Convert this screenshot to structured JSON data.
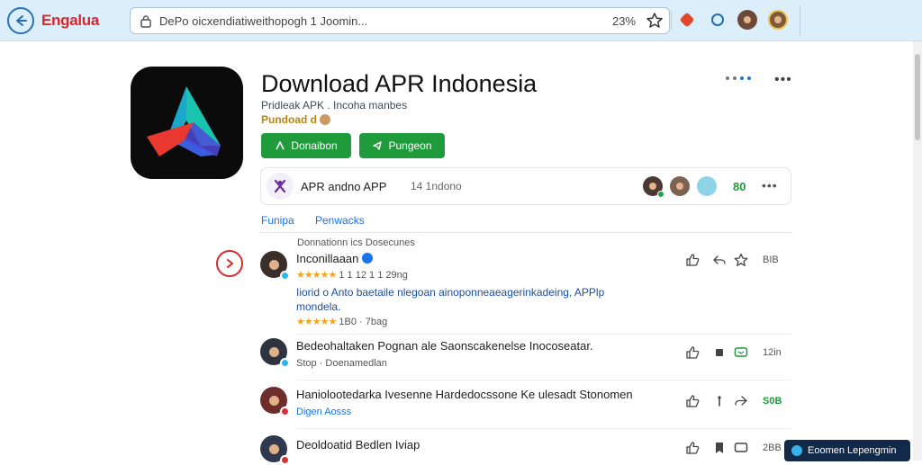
{
  "browser": {
    "app_name": "Engalua",
    "url": "DePo oicxendiatiweithopogh  1  Joomin...",
    "zoom": "23%"
  },
  "app": {
    "title": "Download APR Indonesia",
    "developer": "Pridleak APK . Incoha manbes",
    "category": "Pundoad d",
    "download_label": "Donaibon",
    "share_label": "Pungeon"
  },
  "card": {
    "label": "APR andno APP",
    "version": "14  1ndono",
    "count": "80"
  },
  "tabs": [
    "Funipa",
    "Penwacks"
  ],
  "section_label": "Donnationn ics Dosecunes",
  "reviews": [
    {
      "name": "Inconillaaan",
      "stars": "★★★★★",
      "meta": "1  1  12  1  1  29ng",
      "body": "Iiorid o Anto baetaile nlegoan ainoponneaeagerinkadeing, APPlp mondela.",
      "sub_stars": "★★★★★",
      "sub": "1B0  ·  7bag",
      "count": "BIB"
    },
    {
      "name": "Bedeohaltaken Pognan ale Saonscakenelse Inocoseatar.",
      "sub": "Stop  ·  Doenamedlan",
      "count": "12in"
    },
    {
      "name": "Haniolootedarka Ivesenne Hardedocssone Ke ulesadt Stonomen",
      "sub": "Digen  Aosss",
      "count": "S0B"
    },
    {
      "name": "Deoldoatid Bedlen Iviap",
      "sub": "",
      "count": "2BB"
    }
  ],
  "chip_label": "Eoomen Lepengmin",
  "colors": {
    "accent": "#1a73e8",
    "download": "#1f9b3c",
    "brand_red": "#d7262b",
    "topbar": "#dceefa"
  },
  "icons": [
    "back-arrow-icon",
    "lock-icon",
    "star-icon",
    "alert-icon",
    "sync-icon",
    "download-icon",
    "share-icon",
    "thumb-up-icon",
    "more-icon"
  ]
}
